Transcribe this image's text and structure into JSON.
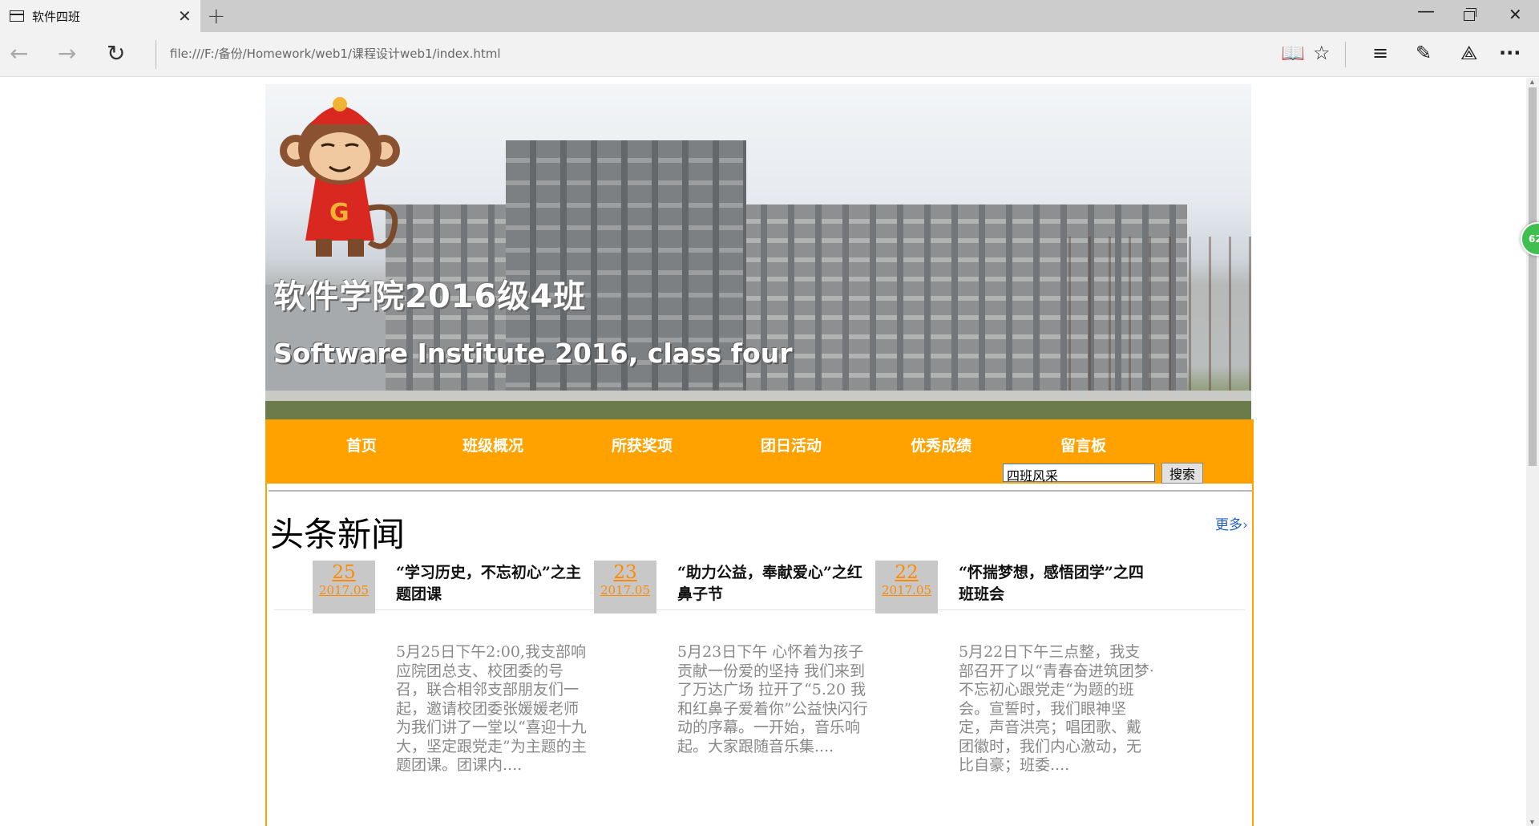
{
  "browser": {
    "tab_title": "软件四班",
    "address": "file:///F:/备份/Homework/web1/课程设计web1/index.html",
    "side_badge": "62"
  },
  "banner": {
    "title": "软件学院2016级4班",
    "subtitle": "Software Institute 2016, class four"
  },
  "nav": {
    "items": [
      "首页",
      "班级概况",
      "所获奖项",
      "团日活动",
      "优秀成绩",
      "留言板"
    ]
  },
  "search": {
    "value": "四班风采",
    "button": "搜索"
  },
  "news": {
    "heading": "头条新闻",
    "more": "更多›",
    "cards": [
      {
        "day": "25",
        "month": "2017.05",
        "title": "“学习历史，不忘初心”之主题团课",
        "summary": "5月25日下午2:00,我支部响应院团总支、校团委的号召，联合相邻支部朋友们一起，邀请校团委张媛媛老师为我们讲了一堂以“喜迎十九大，坚定跟党走”为主题的主题团课。团课内...."
      },
      {
        "day": "23",
        "month": "2017.05",
        "title": "“助力公益，奉献爱心”之红鼻子节",
        "summary": "5月23日下午 心怀着为孩子贡献一份爱的坚持 我们来到了万达广场 拉开了“5.20 我和红鼻子爱着你”公益快闪行动的序幕。一开始，音乐响起。大家跟随音乐集...."
      },
      {
        "day": "22",
        "month": "2017.05",
        "title": "“怀揣梦想，感悟团学”之四班班会",
        "summary": "5月22日下午三点整，我支部召开了以“青春奋进筑团梦·不忘初心跟党走“为题的班会。宣誓时，我们眼神坚定，声音洪亮；唱团歌、戴团徽时，我们内心激动，无比自豪；班委...."
      }
    ]
  },
  "colors": {
    "nav_bg": "#ffa200",
    "date_text": "#ff8a00",
    "more_link": "#1f5fbf"
  }
}
